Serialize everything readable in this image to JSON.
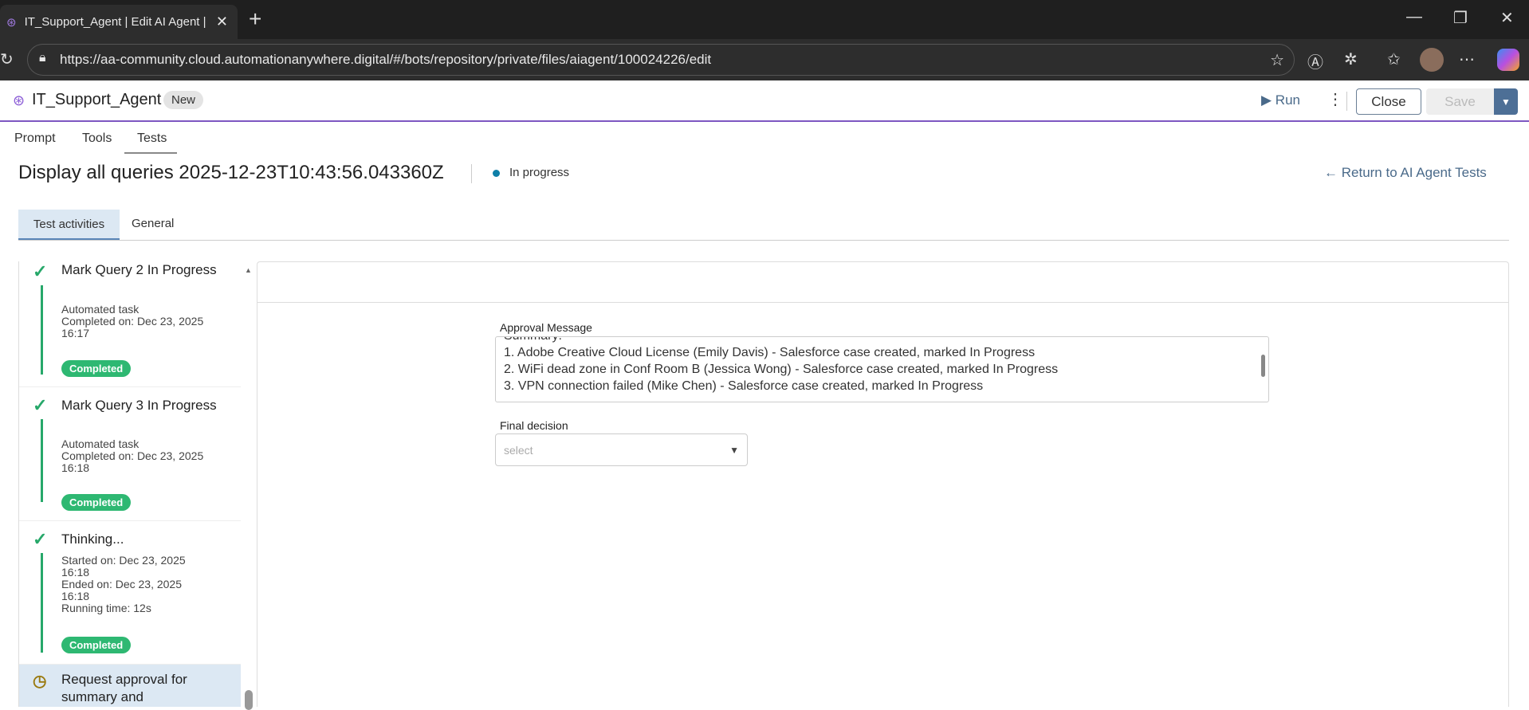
{
  "browser": {
    "tab_title": "IT_Support_Agent | Edit AI Agent |",
    "url": "https://aa-community.cloud.automationanywhere.digital/#/bots/repository/private/files/aiagent/100024226/edit"
  },
  "header": {
    "agent_name": "IT_Support_Agent",
    "badge": "New",
    "run_label": "Run",
    "close_label": "Close",
    "save_label": "Save"
  },
  "nav_tabs": [
    "Prompt",
    "Tools",
    "Tests"
  ],
  "page": {
    "title": "Display all queries 2025-12-23T10:43:56.043360Z",
    "status": "In progress",
    "return_link": "Return to AI Agent Tests",
    "status_color": "#0e7fa8"
  },
  "sub_tabs": [
    "Test activities",
    "General"
  ],
  "activities": [
    {
      "title": "Mark Query 2 In Progress",
      "lines": [
        "Automated task",
        "Completed on: Dec 23, 2025",
        "16:17"
      ],
      "status": "Completed"
    },
    {
      "title": "Mark Query 3 In Progress",
      "lines": [
        "Automated task",
        "Completed on: Dec 23, 2025",
        "16:18"
      ],
      "status": "Completed"
    },
    {
      "title": "Thinking...",
      "lines": [
        "Started on: Dec 23, 2025",
        "16:18",
        "Ended on: Dec 23, 2025",
        "16:18",
        "Running time: 12s"
      ],
      "status": "Completed"
    },
    {
      "title": "Request approval for summary and"
    }
  ],
  "form": {
    "approval_label": "Approval Message",
    "approval_lines": [
      "Summary:",
      "1. Adobe Creative Cloud License (Emily Davis) - Salesforce case created, marked In Progress",
      "2. WiFi dead zone in Conf Room B (Jessica Wong) - Salesforce case created, marked In Progress",
      "3. VPN connection failed (Mike Chen) - Salesforce case created, marked In Progress"
    ],
    "decision_label": "Final decision",
    "decision_placeholder": "select"
  }
}
